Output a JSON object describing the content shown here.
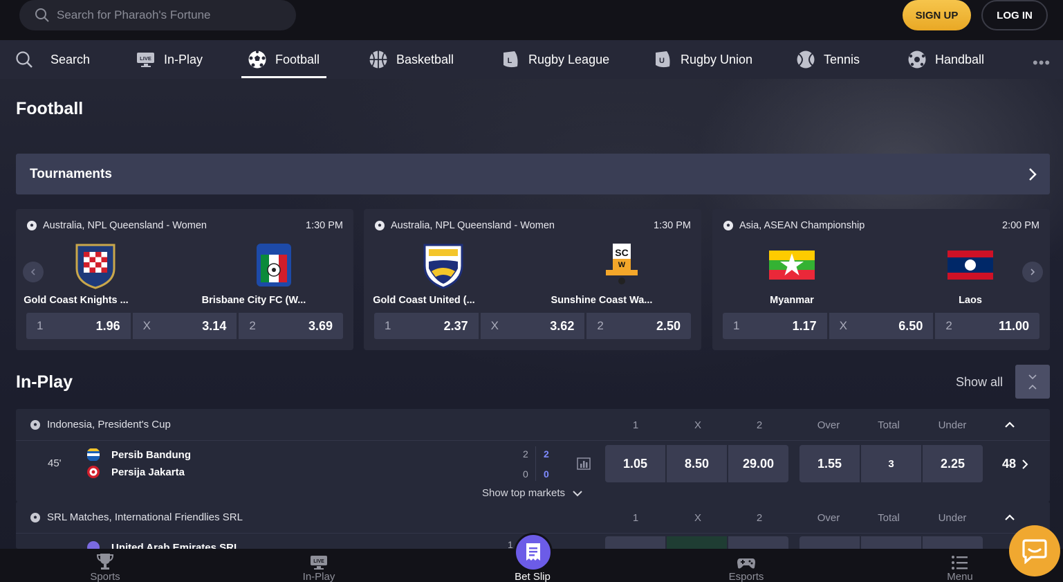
{
  "header": {
    "search_placeholder": "Search for Pharaoh's Fortune",
    "signup_label": "SIGN UP",
    "login_label": "LOG IN"
  },
  "sportnav": {
    "items": [
      {
        "label": "Search",
        "icon": "search-icon"
      },
      {
        "label": "In-Play",
        "icon": "live-icon"
      },
      {
        "label": "Football",
        "icon": "football-icon",
        "active": true
      },
      {
        "label": "Basketball",
        "icon": "basketball-icon"
      },
      {
        "label": "Rugby League",
        "icon": "rugby-league-icon"
      },
      {
        "label": "Rugby Union",
        "icon": "rugby-union-icon"
      },
      {
        "label": "Tennis",
        "icon": "tennis-icon"
      },
      {
        "label": "Handball",
        "icon": "handball-icon"
      }
    ],
    "more_label": "•••"
  },
  "page": {
    "title": "Football",
    "tournaments_label": "Tournaments"
  },
  "featured": [
    {
      "league": "Australia, NPL Queensland - Women",
      "time": "1:30 PM",
      "home": "Gold Coast Knights ...",
      "away": "Brisbane City FC (W...",
      "odds": [
        {
          "label": "1",
          "value": "1.96"
        },
        {
          "label": "X",
          "value": "3.14"
        },
        {
          "label": "2",
          "value": "3.69"
        }
      ]
    },
    {
      "league": "Australia, NPL Queensland - Women",
      "time": "1:30 PM",
      "home": "Gold Coast United (...",
      "away": "Sunshine Coast Wa...",
      "odds": [
        {
          "label": "1",
          "value": "2.37"
        },
        {
          "label": "X",
          "value": "3.62"
        },
        {
          "label": "2",
          "value": "2.50"
        }
      ]
    },
    {
      "league": "Asia, ASEAN Championship",
      "time": "2:00 PM",
      "home": "Myanmar",
      "away": "Laos",
      "odds": [
        {
          "label": "1",
          "value": "1.17"
        },
        {
          "label": "X",
          "value": "6.50"
        },
        {
          "label": "2",
          "value": "11.00"
        }
      ]
    }
  ],
  "inplay": {
    "title": "In-Play",
    "show_all": "Show all",
    "columns": [
      "1",
      "X",
      "2",
      "Over",
      "Total",
      "Under"
    ],
    "sections": [
      {
        "league": "Indonesia, President's Cup",
        "match": {
          "minute": "45'",
          "home": "Persib Bandung",
          "away": "Persija Jakarta",
          "home_score_a": "2",
          "home_score_b": "2",
          "away_score_a": "0",
          "away_score_b": "0",
          "odds_1x2": [
            "1.05",
            "8.50",
            "29.00"
          ],
          "odds_ou": [
            "1.55",
            "3",
            "2.25"
          ],
          "more_markets": "48"
        },
        "show_top_markets": "Show top markets"
      },
      {
        "league": "SRL Matches, International Friendlies SRL",
        "match": {
          "home": "United Arab Emirates SRL",
          "home_score_a": "1"
        }
      }
    ]
  },
  "bottomnav": {
    "items": [
      {
        "label": "Sports",
        "icon": "trophy-icon"
      },
      {
        "label": "In-Play",
        "icon": "live-icon"
      },
      {
        "label": "Bet Slip",
        "icon": "betslip-icon"
      },
      {
        "label": "Esports",
        "icon": "gamepad-icon"
      },
      {
        "label": "Menu",
        "icon": "menu-icon"
      }
    ]
  },
  "colors": {
    "accent_gold": "#f0b63a",
    "betslip_purple": "#6c5ce7",
    "panel": "#292b3b",
    "odd_cell": "#3a3d52"
  }
}
